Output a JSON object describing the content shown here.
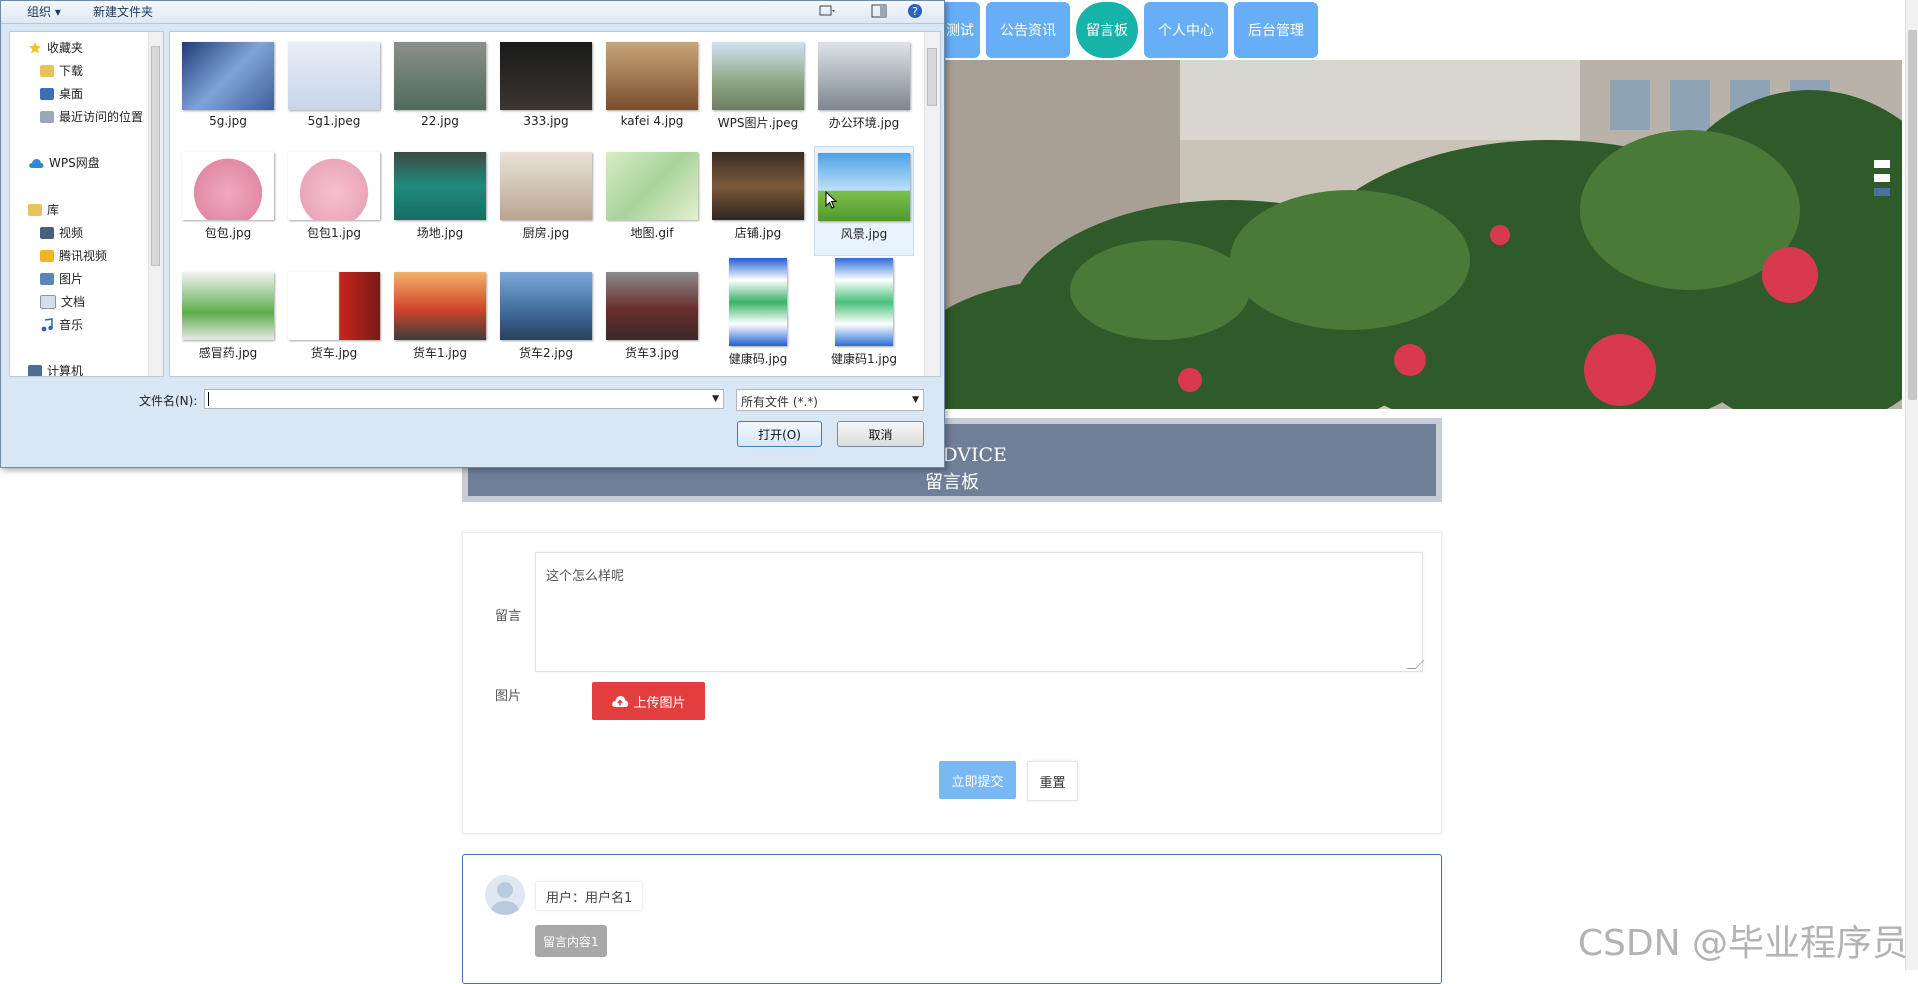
{
  "nav": {
    "items": [
      "测试",
      "公告资讯",
      "留言板",
      "个人中心",
      "后台管理"
    ],
    "active": "留言板"
  },
  "board": {
    "title_en": "S / ADVICE",
    "title_cn": "留言板"
  },
  "form": {
    "message_label": "留言",
    "message_value": "这个怎么样呢",
    "image_label": "图片",
    "upload_label": "上传图片",
    "submit_label": "立即提交",
    "reset_label": "重置"
  },
  "comment": {
    "user": "用户：用户名1",
    "content": "留言内容1"
  },
  "watermark": "CSDN @毕业程序员",
  "dialog": {
    "toolbar": {
      "organize": "组织 ▾",
      "new_folder": "新建文件夹"
    },
    "tree": {
      "favorites": "收藏夹",
      "downloads": "下载",
      "desktop": "桌面",
      "recent": "最近访问的位置",
      "wps": "WPS网盘",
      "library": "库",
      "video": "视频",
      "tencent_video": "腾讯视频",
      "pictures": "图片",
      "documents": "文档",
      "music": "音乐",
      "computer": "计算机"
    },
    "files": [
      "5g.jpg",
      "5g1.jpeg",
      "22.jpg",
      "333.jpg",
      "kafei 4.jpg",
      "WPS图片.jpeg",
      "办公环境.jpg",
      "包包.jpg",
      "包包1.jpg",
      "场地.jpg",
      "厨房.jpg",
      "地图.gif",
      "店铺.jpg",
      "风景.jpg",
      "感冒药.jpg",
      "货车.jpg",
      "货车1.jpg",
      "货车2.jpg",
      "货车3.jpg",
      "健康码.jpg",
      "健康码1.jpg"
    ],
    "filename_label": "文件名(N):",
    "filename_value": "",
    "filter_value": "所有文件 (*.*)",
    "open_label": "打开(O)",
    "cancel_label": "取消"
  },
  "colors": {
    "nav_blue": "#66aef6",
    "nav_active": "#16b3a8",
    "title_bg": "#707f98",
    "upload_red": "#e33e3f",
    "submit_blue": "#79b8f2"
  }
}
